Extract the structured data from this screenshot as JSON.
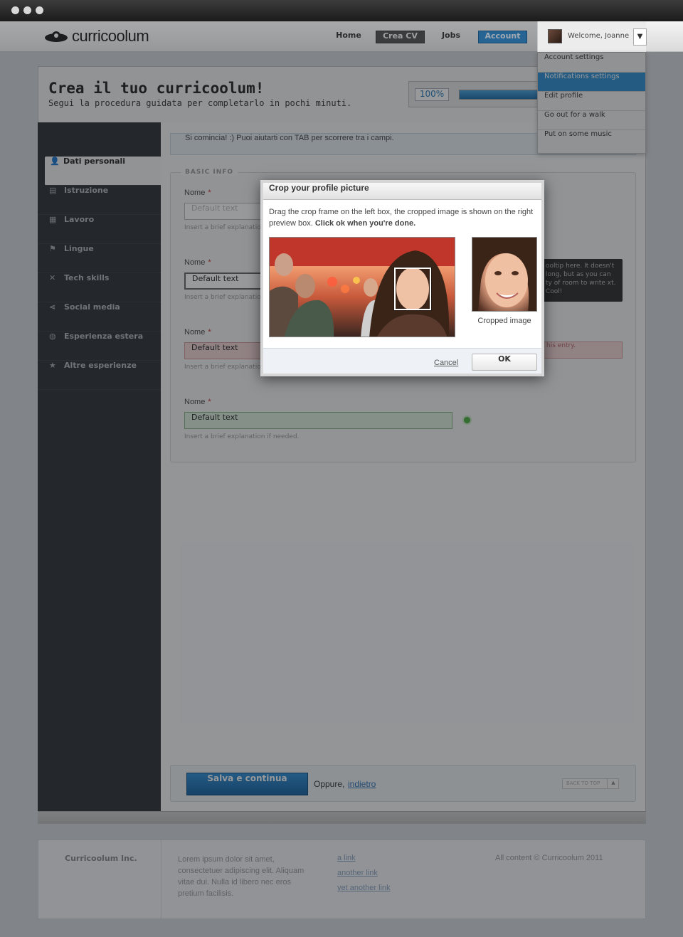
{
  "header": {
    "logo": "curricoolum",
    "nav": [
      {
        "label": "Home"
      },
      {
        "label": "Crea CV"
      },
      {
        "label": "Jobs"
      },
      {
        "label": "Account"
      }
    ],
    "welcome": "Welcome, Joanne",
    "dropdown_toggle_icon": "▼"
  },
  "dropdown": {
    "items": [
      {
        "label": "Account settings"
      },
      {
        "label": "Notifications settings"
      },
      {
        "label": "Edit profile"
      },
      {
        "label": "Go out for a walk"
      },
      {
        "label": "Put on some music"
      }
    ]
  },
  "panel": {
    "title": "Crea il tuo curricoolum!",
    "subtitle": "Segui la procedura guidata per completarlo in pochi minuti.",
    "progress_label": "100%",
    "progress_fraction": 1.0
  },
  "sidebar": {
    "items": [
      {
        "label": "Dati personali",
        "icon": "👤"
      },
      {
        "label": "Istruzione",
        "icon": "▤"
      },
      {
        "label": "Lavoro",
        "icon": "▦"
      },
      {
        "label": "Lingue",
        "icon": "⚑"
      },
      {
        "label": "Tech skills",
        "icon": "✕"
      },
      {
        "label": "Social media",
        "icon": "⋖"
      },
      {
        "label": "Esperienza estera",
        "icon": "◍"
      },
      {
        "label": "Altre esperienze",
        "icon": "★"
      }
    ]
  },
  "form": {
    "notice": "Si comincia! :) Puoi aiutarti con TAB per scorrere tra i campi.",
    "legend": "BASIC INFO",
    "fields": [
      {
        "label": "Nome",
        "required": "*",
        "value": "Default text",
        "help": "Insert a brief explanation if needed."
      },
      {
        "label": "Nome",
        "required": "*",
        "value": "Default text",
        "help": "Insert a brief explanation if needed."
      },
      {
        "label": "Nome",
        "required": "*",
        "value": "Default text",
        "help": "Insert a brief explanation if needed."
      },
      {
        "label": "Nome",
        "required": "*",
        "value": "Default text",
        "help": "Insert a brief explanation if needed."
      }
    ],
    "tooltip": "ooltip here. It doesn't long, but as you can ty of room to write xt. Cool!",
    "error_text": "his entry.",
    "save_label": "Salva e continua",
    "or_text": "Oppure,",
    "back_label": "indietro",
    "back_to_top": "BACK TO TOP",
    "back_to_top_icon": "▲"
  },
  "footer": {
    "company": "Curricoolum Inc.",
    "lorem": "Lorem ipsum dolor sit amet, consectetuer adipiscing elit. Aliquam vitae dui. Nulla id libero nec eros pretium facilisis.",
    "links": [
      "a link",
      "another link",
      "yet another link"
    ],
    "copyright": "All content © Curricoolum 2011"
  },
  "modal": {
    "title": "Crop your profile picture",
    "description": "Drag the crop frame on the left box, the cropped image is shown on the right preview box.",
    "description_bold": "Click ok when you're done.",
    "preview_label": "Cropped image",
    "cancel_label": "Cancel",
    "ok_label": "OK"
  }
}
